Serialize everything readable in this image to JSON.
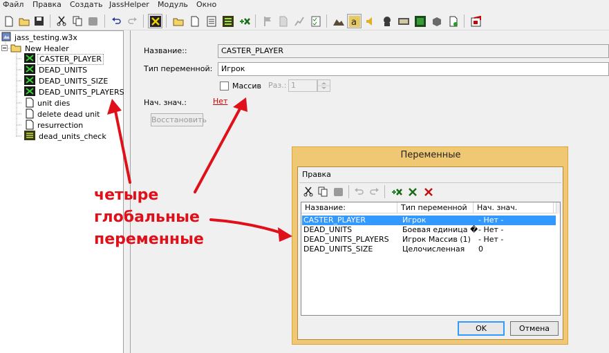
{
  "menu": [
    "Файл",
    "Правка",
    "Создать",
    "JassHelper",
    "Модуль",
    "Окно"
  ],
  "tree": {
    "map_file": "jass_testing.w3x",
    "category": "New Healer",
    "items": [
      {
        "label": "CASTER_PLAYER",
        "icon": "variable-icon"
      },
      {
        "label": "DEAD_UNITS",
        "icon": "variable-icon"
      },
      {
        "label": "DEAD_UNITS_SIZE",
        "icon": "variable-icon"
      },
      {
        "label": "DEAD_UNITS_PLAYERS",
        "icon": "variable-icon"
      },
      {
        "label": "unit dies",
        "icon": "trigger-icon"
      },
      {
        "label": "delete dead unit",
        "icon": "trigger-icon"
      },
      {
        "label": "resurrection",
        "icon": "trigger-icon"
      },
      {
        "label": "dead_units_check",
        "icon": "script-icon"
      }
    ]
  },
  "editor": {
    "name_label": "Название::",
    "name_value": "CASTER_PLAYER",
    "type_label": "Тип переменной:",
    "type_value": "Игрок",
    "array_label": "Массив",
    "array_checked": false,
    "size_label": "Раз.:",
    "size_value": "1",
    "init_label": "Нач. знач.:",
    "init_value": "Нет",
    "reset_button": "Восстановить"
  },
  "annotation": {
    "line1": "четыре",
    "line2": "глобальные",
    "line3": "переменные",
    "color": "#e0101a"
  },
  "dialog": {
    "title": "Переменные",
    "menu": "Правка",
    "columns": [
      "Название:",
      "Тип переменной",
      "Нач. знач."
    ],
    "rows": [
      {
        "name": "CASTER_PLAYER",
        "type": "Игрок",
        "init": "- Нет -",
        "selected": true
      },
      {
        "name": "DEAD_UNITS",
        "type": "Боевая единица �",
        "init": "- Нет -",
        "selected": false
      },
      {
        "name": "DEAD_UNITS_PLAYERS",
        "type": "Игрок Массив (1)",
        "init": "- Нет -",
        "selected": false
      },
      {
        "name": "DEAD_UNITS_SIZE",
        "type": "Целочисленная",
        "init": "0",
        "selected": false
      }
    ],
    "ok_button": "OK",
    "cancel_button": "Отмена"
  }
}
